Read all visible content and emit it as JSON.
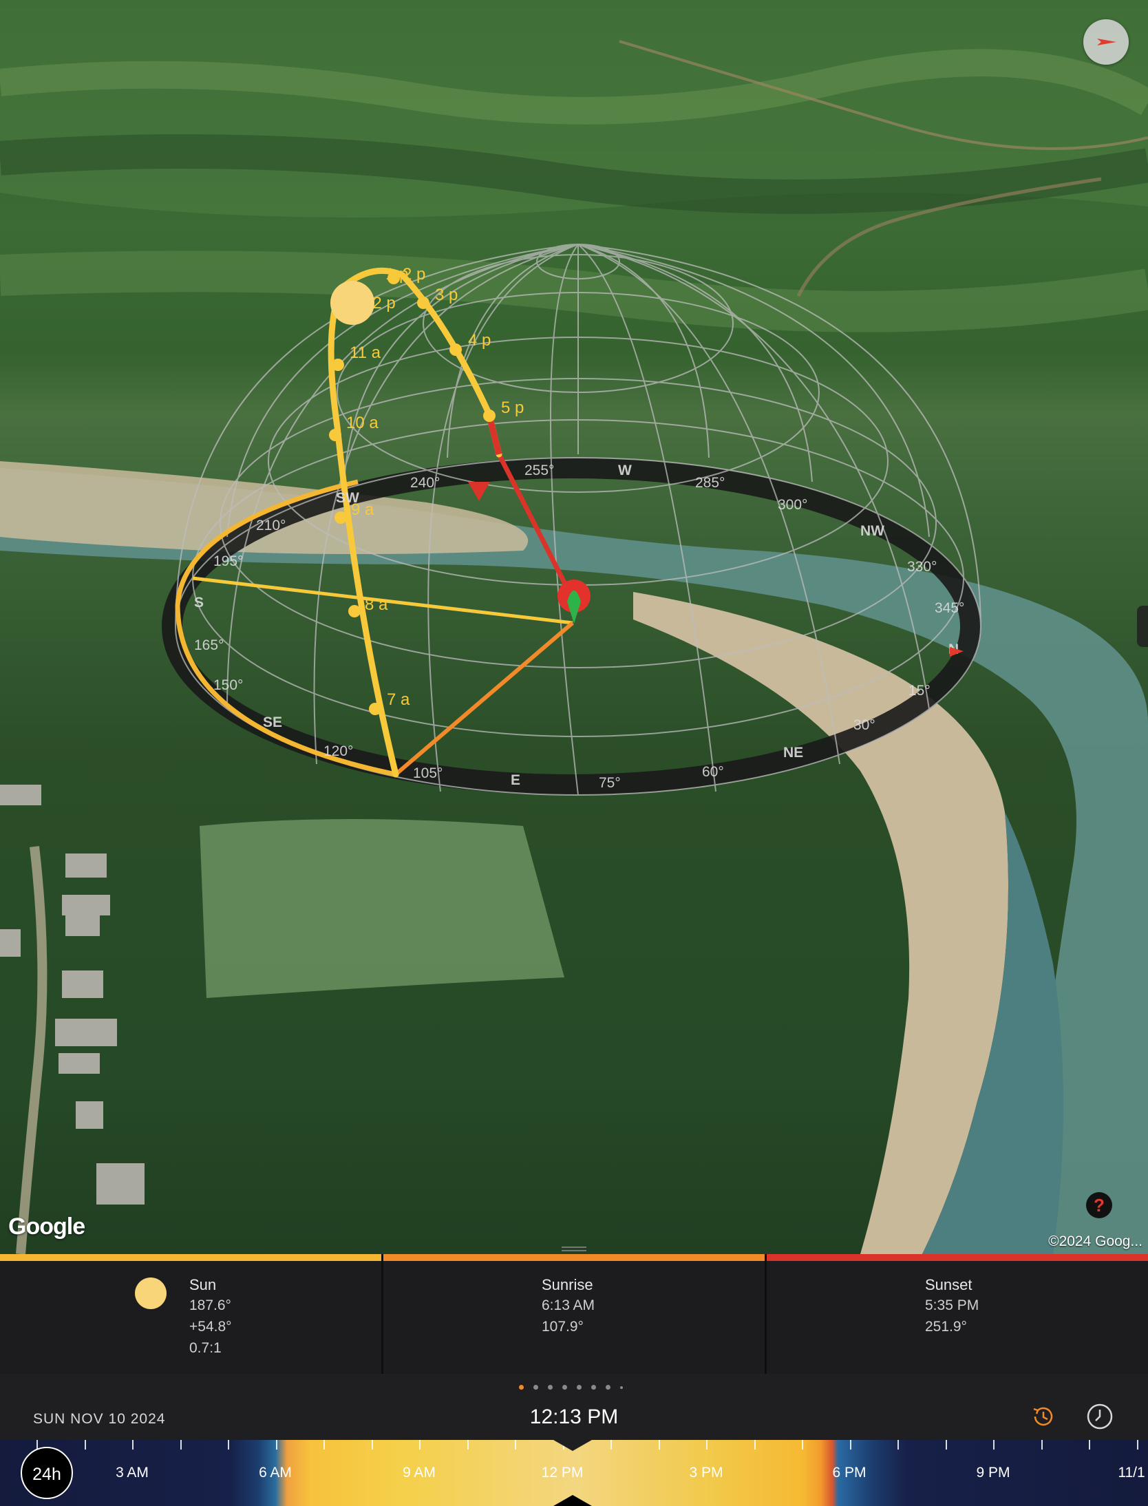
{
  "map": {
    "logo": "Google",
    "copyright": "©2024 Goog...",
    "help_label": "?",
    "colors": {
      "sun_path": "#f7c93b",
      "sunrise": "#f28a2a",
      "sunset": "#d9332a"
    },
    "hour_labels": [
      "7 a",
      "8 a",
      "9 a",
      "10 a",
      "11 a",
      "12 p",
      "1 p",
      "2 p",
      "3 p",
      "4 p",
      "5 p"
    ],
    "compass_labels": [
      "240°",
      "255°",
      "W",
      "285°",
      "300°",
      "NW",
      "330°",
      "345°",
      "N",
      "15°",
      "30°",
      "NE",
      "60°",
      "75°",
      "E",
      "105°",
      "120°",
      "SE",
      "150°",
      "165°",
      "S",
      "195°",
      "210°",
      "SW"
    ]
  },
  "info": {
    "sun": {
      "title": "Sun",
      "azimuth": "187.6°",
      "elevation": "+54.8°",
      "shadow_ratio": "0.7:1",
      "color": "#f9d57a"
    },
    "sunrise": {
      "title": "Sunrise",
      "time": "6:13 AM",
      "azimuth": "107.9°",
      "color": "#f28a2a"
    },
    "sunset": {
      "title": "Sunset",
      "time": "5:35 PM",
      "azimuth": "251.9°",
      "color": "#d9332a"
    }
  },
  "time_row": {
    "date": "SUN NOV 10 2024",
    "time": "12:13 PM",
    "page_dots": 8,
    "active_dot": 0
  },
  "timeline": {
    "mode": "24h",
    "labels": [
      "3 AM",
      "6 AM",
      "9 AM",
      "12 PM",
      "3 PM",
      "6 PM",
      "9 PM",
      "11/1"
    ]
  }
}
